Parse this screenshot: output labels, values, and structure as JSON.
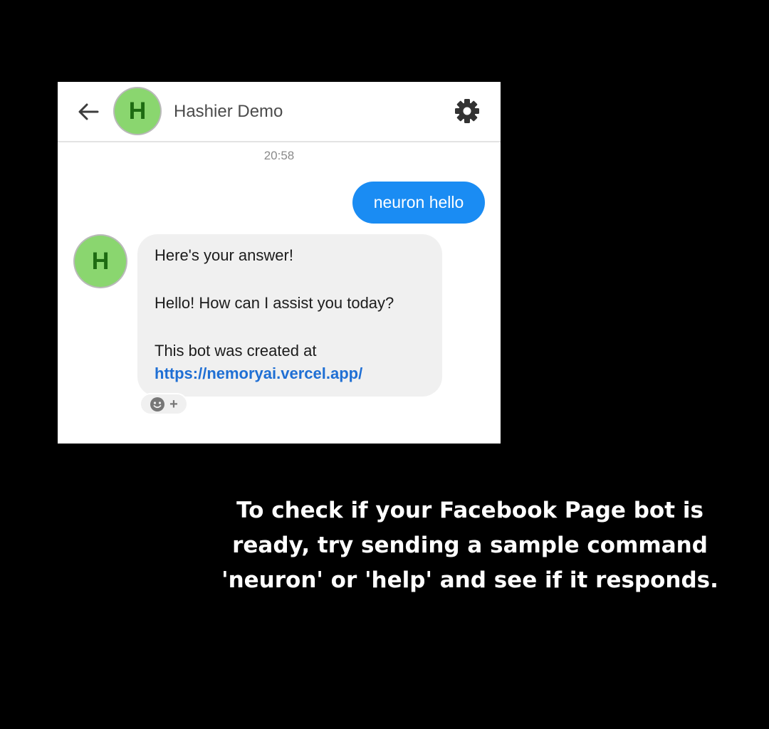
{
  "header": {
    "back_icon": "arrow-left-icon",
    "avatar_letter": "H",
    "title": "Hashier Demo",
    "settings_icon": "gear-icon"
  },
  "conversation": {
    "timestamp": "20:58",
    "sent_message": "neuron hello",
    "received": {
      "avatar_letter": "H",
      "line1": "Here's your answer!",
      "line2": "Hello! How can I assist you today?",
      "line3": "This bot was created at",
      "link": "https://nemoryai.vercel.app/"
    },
    "reaction_icon": "smiley-add-icon",
    "reaction_plus": "+"
  },
  "caption": "To check if your Facebook Page bot is ready, try sending a sample command 'neuron' or 'help' and see if it responds.",
  "colors": {
    "sent_bubble": "#1a8cf3",
    "received_bubble": "#f0f0f0",
    "avatar_bg": "#8ad66f",
    "avatar_letter": "#1e6b12",
    "link": "#1f6fd4",
    "background": "#000000"
  }
}
